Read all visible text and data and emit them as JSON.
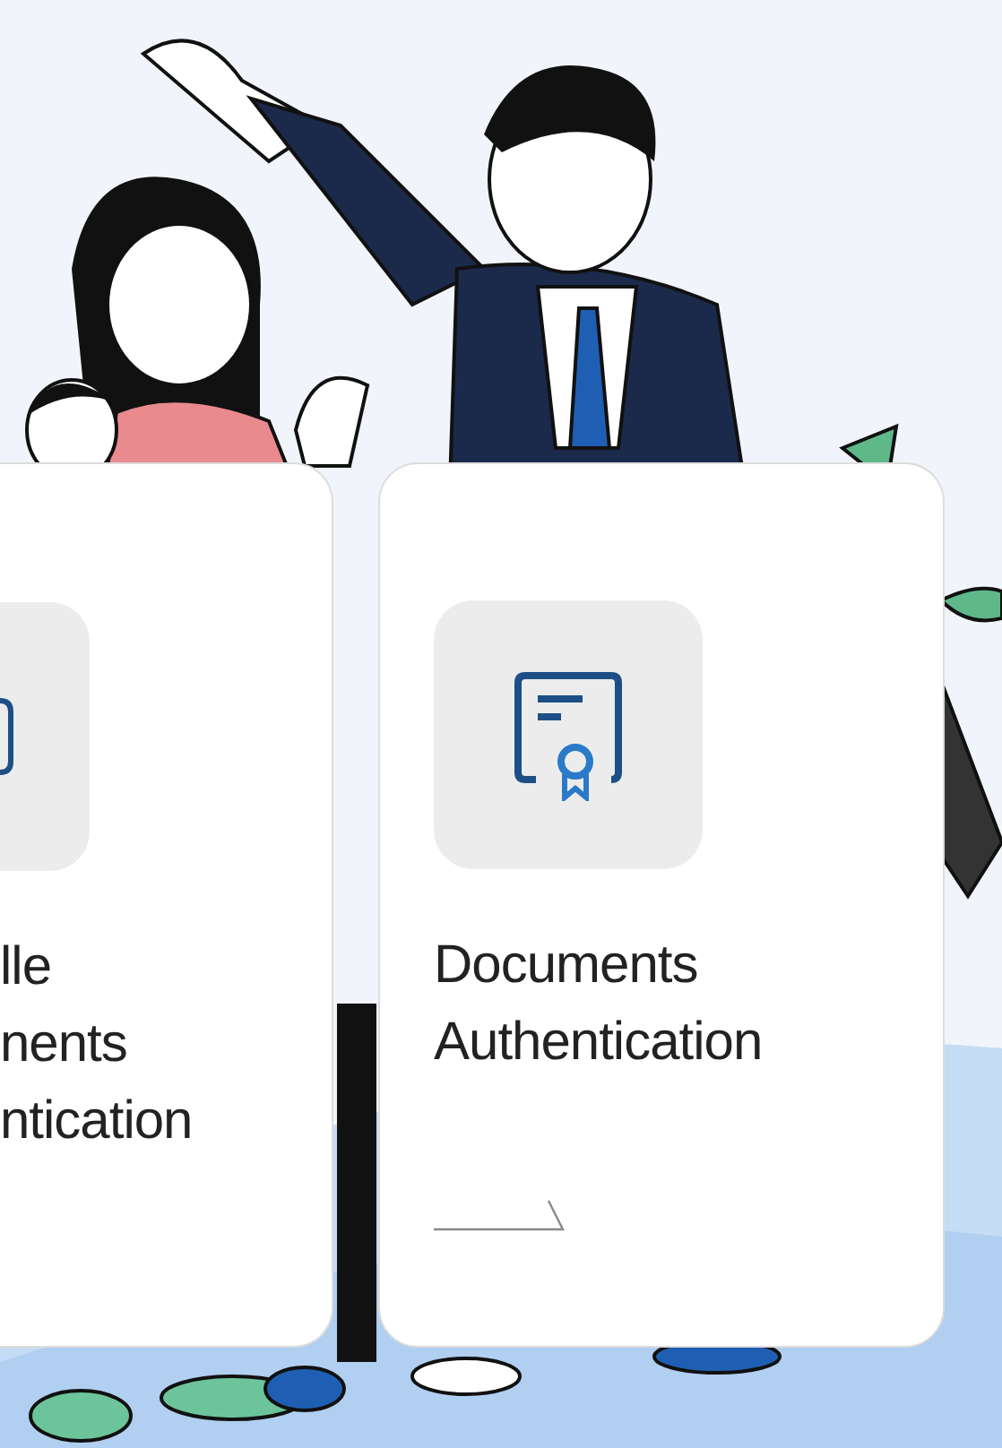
{
  "cards": [
    {
      "kind": "cut",
      "title": [
        "lle",
        "nents",
        "ntication"
      ]
    },
    {
      "kind": "full",
      "title": [
        "Documents",
        "Authentication"
      ]
    }
  ]
}
